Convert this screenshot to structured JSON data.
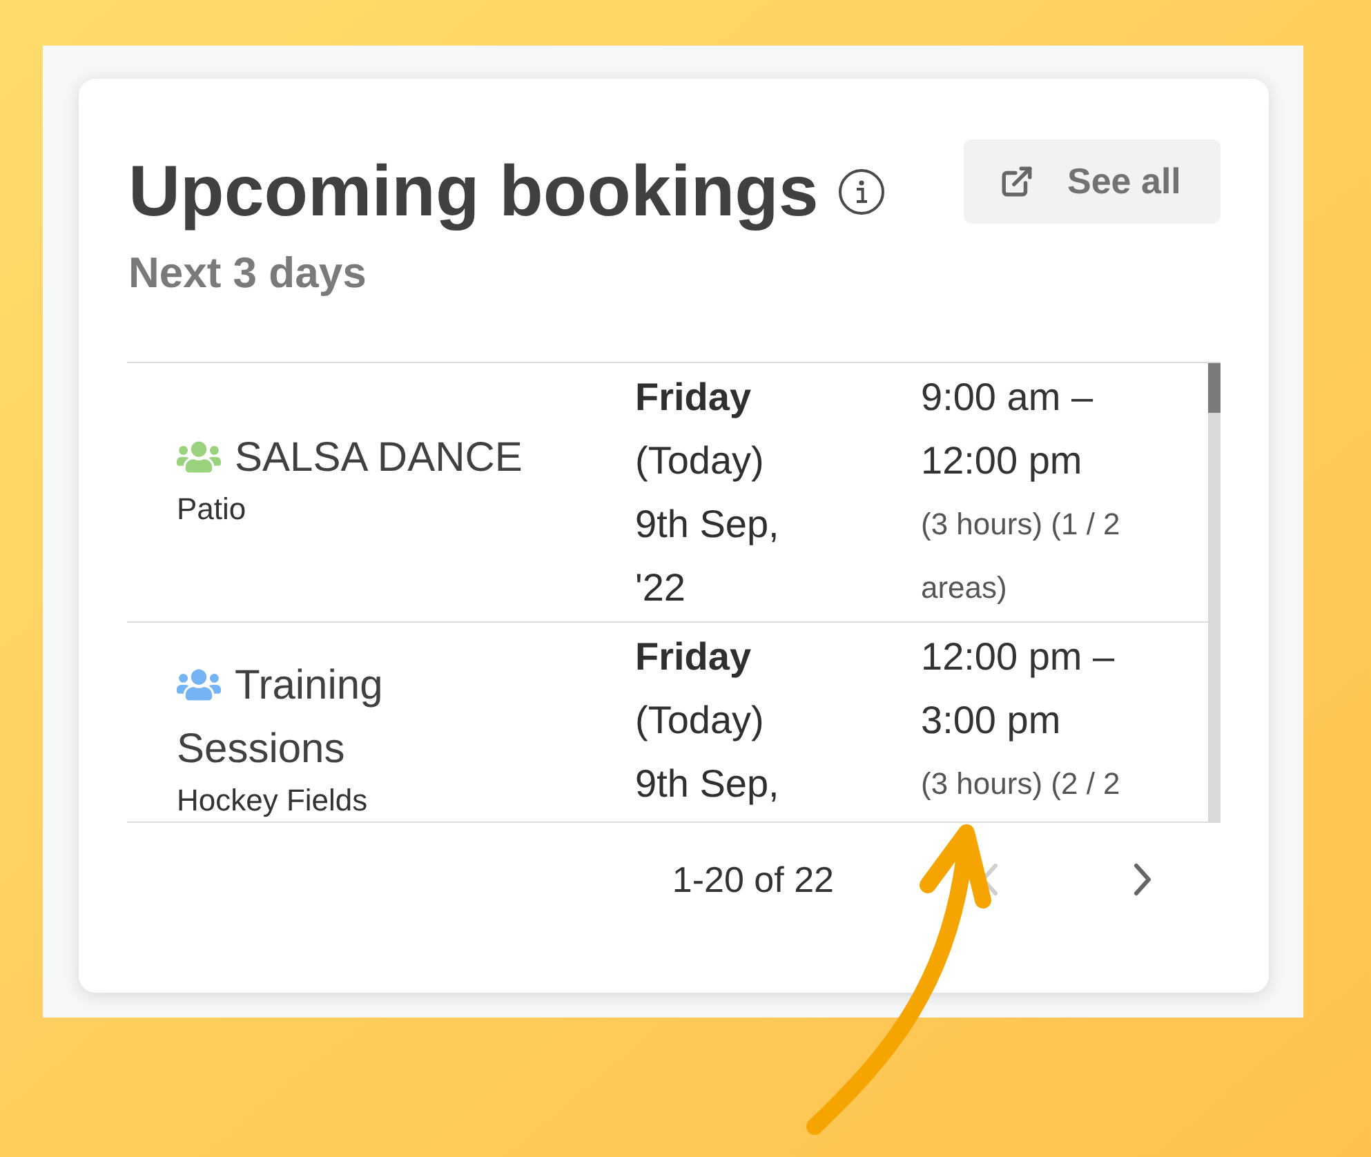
{
  "card": {
    "title": "Upcoming bookings",
    "subtitle": "Next 3 days",
    "see_all_button": {
      "label": "See all"
    }
  },
  "bookings": [
    {
      "name": "SALSA DANCE",
      "color": "#9bd27e",
      "location": "Patio",
      "day": "Friday",
      "day_note": "(Today)",
      "date": "9th Sep, '22",
      "time": "9:00 am – 12:00 pm",
      "details": "(3 hours) (1 / 2 areas)"
    },
    {
      "name": "Training Sessions",
      "color": "#74b4f4",
      "location": "Hockey Fields",
      "day": "Friday",
      "day_note": "(Today)",
      "date": "9th Sep,",
      "time": "12:00 pm – 3:00 pm",
      "details": "(3 hours) (2 / 2"
    }
  ],
  "pagination": {
    "range": "1-20 of 22",
    "previous": {
      "disabled": true
    },
    "next": {
      "disabled": false
    }
  }
}
